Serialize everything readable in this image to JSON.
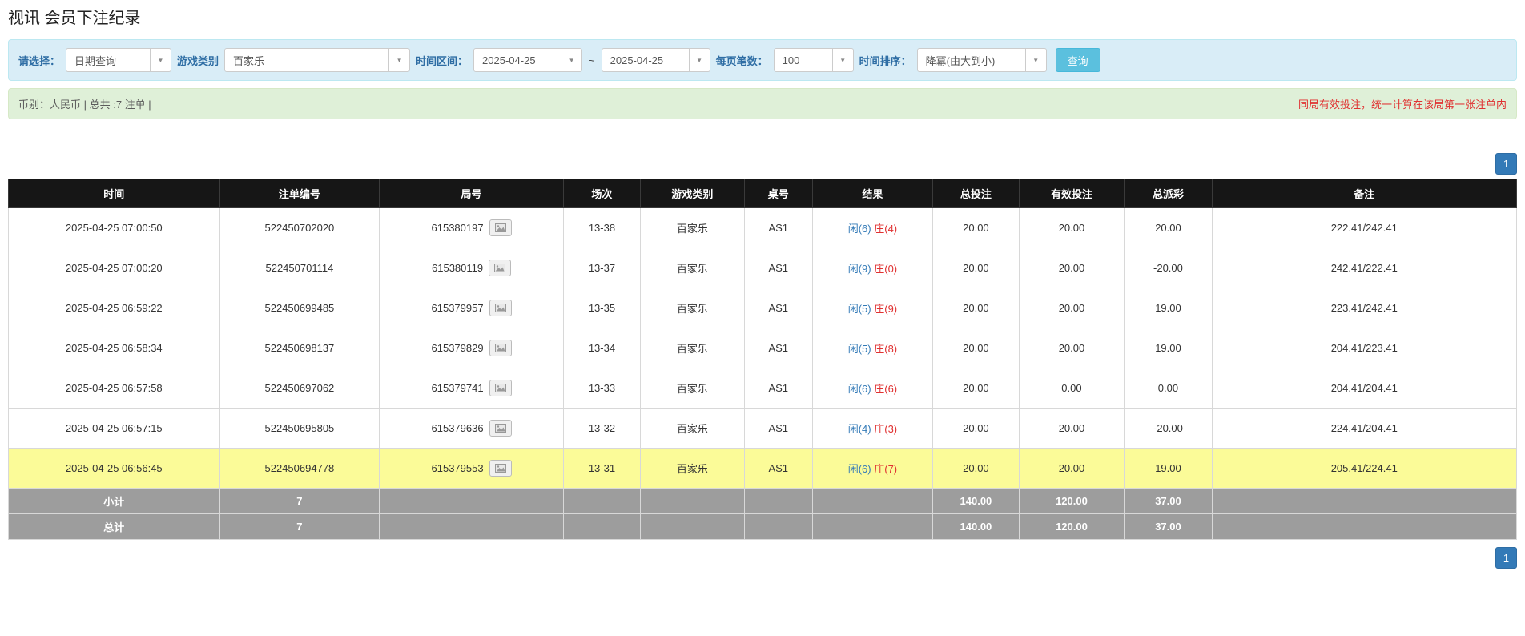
{
  "page": {
    "title": "视讯 会员下注纪录"
  },
  "filters": {
    "query_type_label": "请选择：",
    "query_type_value": "日期查询",
    "game_type_label": "游戏类别",
    "game_type_value": "百家乐",
    "time_range_label": "时间区间：",
    "date_from": "2025-04-25",
    "range_separator": "~",
    "date_to": "2025-04-25",
    "page_size_label": "每页笔数：",
    "page_size_value": "100",
    "sort_label": "时间排序：",
    "sort_value": "降冪(由大到小)",
    "search_button": "查询"
  },
  "summary": {
    "left": "币别：人民币 | 总共 :7 注单 |",
    "right": "同局有效投注，统一计算在该局第一张注单内"
  },
  "pagination": {
    "page": "1"
  },
  "table": {
    "headers": [
      "时间",
      "注单编号",
      "局号",
      "场次",
      "游戏类别",
      "桌号",
      "结果",
      "总投注",
      "有效投注",
      "总派彩",
      "备注"
    ],
    "rows": [
      {
        "time": "2025-04-25 07:00:50",
        "bet_id": "522450702020",
        "round_id": "615380197",
        "session": "13-38",
        "game": "百家乐",
        "table": "AS1",
        "result_xian": "闲(6)",
        "result_zhuang": "庄(4)",
        "total_bet": "20.00",
        "valid_bet": "20.00",
        "payout": "20.00",
        "note": "222.41/242.41",
        "highlight": false
      },
      {
        "time": "2025-04-25 07:00:20",
        "bet_id": "522450701114",
        "round_id": "615380119",
        "session": "13-37",
        "game": "百家乐",
        "table": "AS1",
        "result_xian": "闲(9)",
        "result_zhuang": "庄(0)",
        "total_bet": "20.00",
        "valid_bet": "20.00",
        "payout": "-20.00",
        "note": "242.41/222.41",
        "highlight": false
      },
      {
        "time": "2025-04-25 06:59:22",
        "bet_id": "522450699485",
        "round_id": "615379957",
        "session": "13-35",
        "game": "百家乐",
        "table": "AS1",
        "result_xian": "闲(5)",
        "result_zhuang": "庄(9)",
        "total_bet": "20.00",
        "valid_bet": "20.00",
        "payout": "19.00",
        "note": "223.41/242.41",
        "highlight": false
      },
      {
        "time": "2025-04-25 06:58:34",
        "bet_id": "522450698137",
        "round_id": "615379829",
        "session": "13-34",
        "game": "百家乐",
        "table": "AS1",
        "result_xian": "闲(5)",
        "result_zhuang": "庄(8)",
        "total_bet": "20.00",
        "valid_bet": "20.00",
        "payout": "19.00",
        "note": "204.41/223.41",
        "highlight": false
      },
      {
        "time": "2025-04-25 06:57:58",
        "bet_id": "522450697062",
        "round_id": "615379741",
        "session": "13-33",
        "game": "百家乐",
        "table": "AS1",
        "result_xian": "闲(6)",
        "result_zhuang": "庄(6)",
        "total_bet": "20.00",
        "valid_bet": "0.00",
        "payout": "0.00",
        "note": "204.41/204.41",
        "highlight": false
      },
      {
        "time": "2025-04-25 06:57:15",
        "bet_id": "522450695805",
        "round_id": "615379636",
        "session": "13-32",
        "game": "百家乐",
        "table": "AS1",
        "result_xian": "闲(4)",
        "result_zhuang": "庄(3)",
        "total_bet": "20.00",
        "valid_bet": "20.00",
        "payout": "-20.00",
        "note": "224.41/204.41",
        "highlight": false
      },
      {
        "time": "2025-04-25 06:56:45",
        "bet_id": "522450694778",
        "round_id": "615379553",
        "session": "13-31",
        "game": "百家乐",
        "table": "AS1",
        "result_xian": "闲(6)",
        "result_zhuang": "庄(7)",
        "total_bet": "20.00",
        "valid_bet": "20.00",
        "payout": "19.00",
        "note": "205.41/224.41",
        "highlight": true
      }
    ],
    "subtotal": {
      "label": "小计",
      "count": "7",
      "total_bet": "140.00",
      "valid_bet": "120.00",
      "payout": "37.00"
    },
    "total": {
      "label": "总计",
      "count": "7",
      "total_bet": "140.00",
      "valid_bet": "120.00",
      "payout": "37.00"
    }
  }
}
